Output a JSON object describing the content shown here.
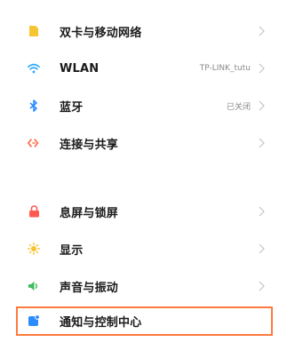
{
  "settings": {
    "items": [
      {
        "label": "双卡与移动网络",
        "value": "",
        "icon": "sim-card-icon",
        "color": "#f6c531"
      },
      {
        "label": "WLAN",
        "value": "TP-LINK_tutu",
        "icon": "wifi-icon",
        "color": "#2ea8ff"
      },
      {
        "label": "蓝牙",
        "value": "已关闭",
        "icon": "bluetooth-icon",
        "color": "#2a8cff"
      },
      {
        "label": "连接与共享",
        "value": "",
        "icon": "connection-share-icon",
        "color": "#ff6b4a"
      },
      {
        "label": "息屏与锁屏",
        "value": "",
        "icon": "lock-icon",
        "color": "#ff5a52"
      },
      {
        "label": "显示",
        "value": "",
        "icon": "sun-icon",
        "color": "#f7c22e"
      },
      {
        "label": "声音与振动",
        "value": "",
        "icon": "speaker-icon",
        "color": "#3dbb5a"
      },
      {
        "label": "通知与控制中心",
        "value": "",
        "icon": "notification-icon",
        "color": "#2b8cff"
      }
    ]
  },
  "highlight_color": "#ff7a3d"
}
